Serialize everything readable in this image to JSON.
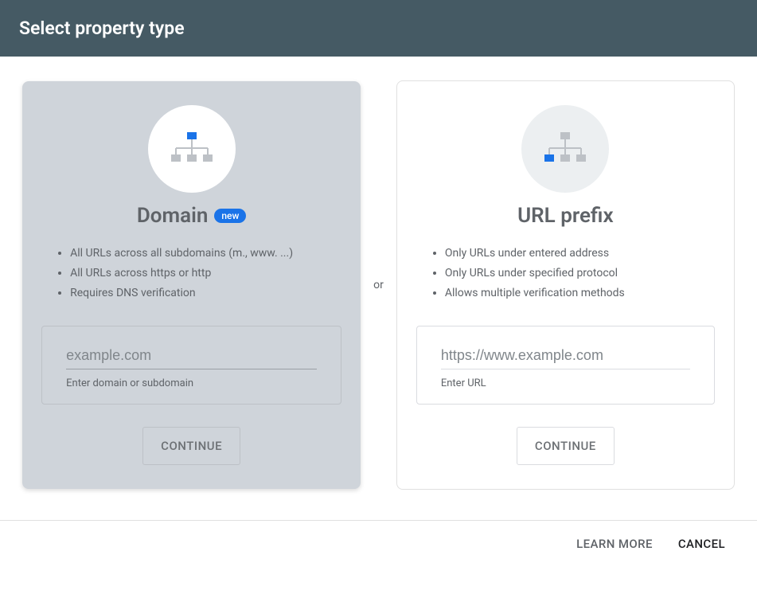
{
  "header": {
    "title": "Select property type"
  },
  "domain_card": {
    "title": "Domain",
    "badge": "new",
    "bullets": [
      "All URLs across all subdomains (m., www. ...)",
      "All URLs across https or http",
      "Requires DNS verification"
    ],
    "input_placeholder": "example.com",
    "input_hint": "Enter domain or subdomain",
    "continue_label": "CONTINUE"
  },
  "separator": "or",
  "url_card": {
    "title": "URL prefix",
    "bullets": [
      "Only URLs under entered address",
      "Only URLs under specified protocol",
      "Allows multiple verification methods"
    ],
    "input_placeholder": "https://www.example.com",
    "input_hint": "Enter URL",
    "continue_label": "CONTINUE"
  },
  "footer": {
    "learn_more": "LEARN MORE",
    "cancel": "CANCEL"
  }
}
